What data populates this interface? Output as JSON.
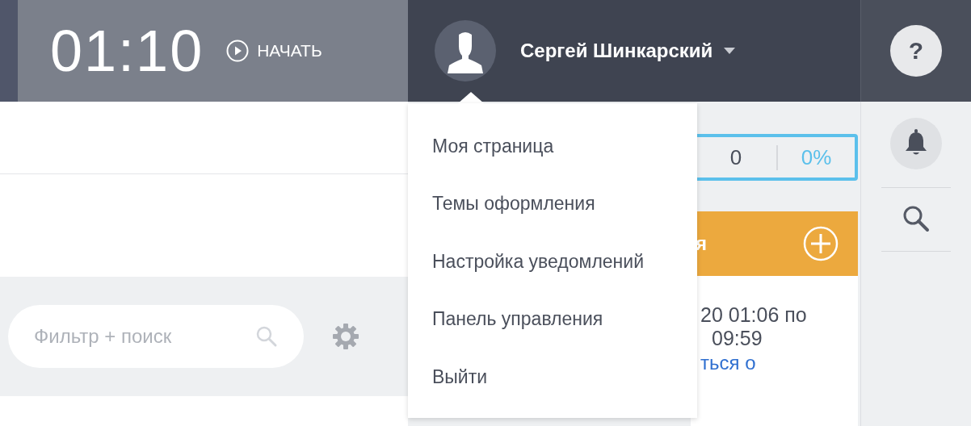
{
  "timer": {
    "time": "01:10",
    "start_label": "НАЧАТЬ"
  },
  "user": {
    "name": "Сергей Шинкарский"
  },
  "user_menu": {
    "expanded": true,
    "items": [
      {
        "label": "Моя страница"
      },
      {
        "label": "Темы оформления"
      },
      {
        "label": "Настройка уведомлений"
      },
      {
        "label": "Панель управления"
      },
      {
        "label": "Выйти"
      }
    ]
  },
  "help_label": "?",
  "counter": {
    "value": "0",
    "percent": "0%"
  },
  "orange_bar": {
    "title": "я"
  },
  "event": {
    "line_1": "20 01:06 по",
    "line_2": "09:59",
    "link": "ться о"
  },
  "search": {
    "placeholder": "Фильтр + поиск"
  }
}
